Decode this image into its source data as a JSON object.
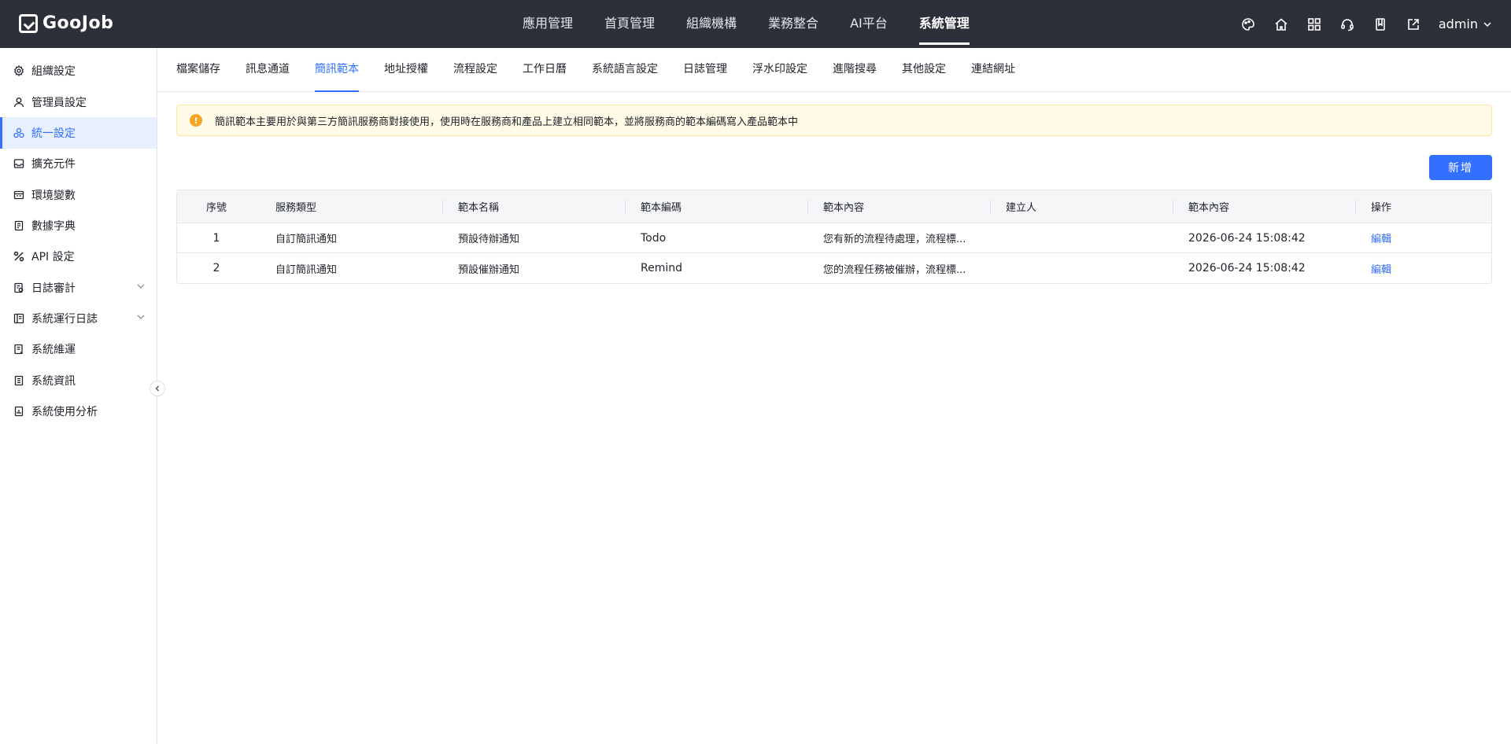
{
  "brand": {
    "name": "GooJob"
  },
  "topnav": {
    "items": [
      {
        "label": "應用管理"
      },
      {
        "label": "首頁管理"
      },
      {
        "label": "組織機構"
      },
      {
        "label": "業務整合"
      },
      {
        "label": "AI平台"
      },
      {
        "label": "系統管理"
      }
    ],
    "active_index": 5
  },
  "top_icons": [
    "palette-icon",
    "home-icon",
    "apps-grid-icon",
    "headset-icon",
    "book-icon",
    "export-icon"
  ],
  "user": {
    "name": "admin"
  },
  "sidebar": {
    "items": [
      {
        "label": "組織設定",
        "icon": "gear-icon"
      },
      {
        "label": "管理員設定",
        "icon": "user-icon"
      },
      {
        "label": "統一設定",
        "icon": "unified-icon"
      },
      {
        "label": "擴充元件",
        "icon": "inbox-icon"
      },
      {
        "label": "環境變數",
        "icon": "variable-icon"
      },
      {
        "label": "數據字典",
        "icon": "dictionary-icon"
      },
      {
        "label": "API 設定",
        "icon": "api-icon"
      },
      {
        "label": "日誌審計",
        "icon": "audit-icon"
      },
      {
        "label": "系統運行日誌",
        "icon": "log-icon"
      },
      {
        "label": "系統維運",
        "icon": "maintenance-icon"
      },
      {
        "label": "系統資訊",
        "icon": "info-icon"
      },
      {
        "label": "系統使用分析",
        "icon": "analysis-icon"
      }
    ],
    "active_index": 2
  },
  "tabs": {
    "items": [
      {
        "label": "檔案儲存"
      },
      {
        "label": "訊息通道"
      },
      {
        "label": "簡訊範本"
      },
      {
        "label": "地址授權"
      },
      {
        "label": "流程設定"
      },
      {
        "label": "工作日曆"
      },
      {
        "label": "系統語言設定"
      },
      {
        "label": "日誌管理"
      },
      {
        "label": "浮水印設定"
      },
      {
        "label": "進階搜尋"
      },
      {
        "label": "其他設定"
      },
      {
        "label": "連結網址"
      }
    ],
    "active_index": 2
  },
  "alert": {
    "text": "簡訊範本主要用於與第三方簡訊服務商對接使用，使用時在服務商和產品上建立相同範本，並將服務商的範本編碼寫入產品範本中",
    "color": "#f5a623"
  },
  "actions": {
    "add_label": "新增"
  },
  "table": {
    "columns": [
      "序號",
      "服務類型",
      "範本名稱",
      "範本編碼",
      "範本內容",
      "建立人",
      "範本內容",
      "操作"
    ],
    "rows": [
      {
        "no": "1",
        "type": "自訂簡訊通知",
        "name": "預設待辦通知",
        "code": "Todo",
        "content": "您有新的流程待處理，流程標...",
        "creator": "",
        "time": "2026-06-24 15:08:42",
        "action": "編輯"
      },
      {
        "no": "2",
        "type": "自訂簡訊通知",
        "name": "預設催辦通知",
        "code": "Remind",
        "content": "您的流程任務被催辦，流程標...",
        "creator": "",
        "time": "2026-06-24 15:08:42",
        "action": "編輯"
      }
    ]
  },
  "colors": {
    "topbar": "#2d3038",
    "accent": "#3370ff",
    "warning": "#f5a623"
  }
}
